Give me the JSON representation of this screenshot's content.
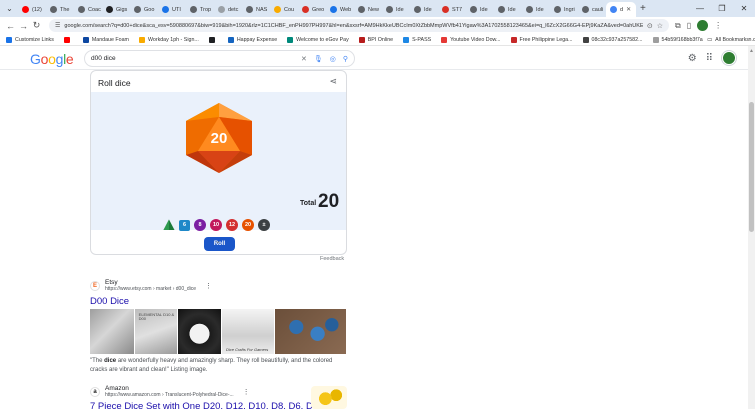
{
  "browser": {
    "tabs": [
      {
        "label": "(12)",
        "color": "#ff0000",
        "active": false
      },
      {
        "label": "The",
        "color": "#5f6368",
        "active": false
      },
      {
        "label": "Coac",
        "color": "#5f6368",
        "active": false
      },
      {
        "label": "Gigs",
        "color": "#202124",
        "active": false
      },
      {
        "label": "Goo",
        "color": "#5f6368",
        "active": false
      },
      {
        "label": "UTI",
        "color": "#1a73e8",
        "active": false
      },
      {
        "label": "Trop",
        "color": "#5f6368",
        "active": false
      },
      {
        "label": "detc",
        "color": "#9aa0a6",
        "active": false
      },
      {
        "label": "NAS",
        "color": "#5f6368",
        "active": false
      },
      {
        "label": "Cou",
        "color": "#f9ab00",
        "active": false
      },
      {
        "label": "Greo",
        "color": "#d93025",
        "active": false
      },
      {
        "label": "Web",
        "color": "#1a73e8",
        "active": false
      },
      {
        "label": "New",
        "color": "#5f6368",
        "active": false
      },
      {
        "label": "Ide",
        "color": "#5f6368",
        "active": false
      },
      {
        "label": "Ide",
        "color": "#5f6368",
        "active": false
      },
      {
        "label": "ST7",
        "color": "#d93025",
        "active": false
      },
      {
        "label": "Ide",
        "color": "#5f6368",
        "active": false
      },
      {
        "label": "Ide",
        "color": "#5f6368",
        "active": false
      },
      {
        "label": "Ide",
        "color": "#5f6368",
        "active": false
      },
      {
        "label": "Ingri",
        "color": "#5f6368",
        "active": false
      },
      {
        "label": "cauli",
        "color": "#5f6368",
        "active": false
      },
      {
        "label": "d",
        "color": "#4285f4",
        "active": true
      }
    ],
    "url": "google.com/search?q=d00+dice&sca_esv=590880697&biw=919&bih=1920&rlz=1C1CHBF_enPH997PH997&hl=en&sxsrf=AM9HkKkeUBCcIm0XtZbbMmpWVfb41Yigaw%3A1702558123465&ei=q_l6ZcX2G66G4-EPj9KaZA&ved=0ahUKEwiN-KGh...",
    "bookmarks": [
      {
        "label": "Customize Links",
        "color": "#1a73e8"
      },
      {
        "label": "",
        "color": "#ff0000"
      },
      {
        "label": "Mandaue Foam",
        "color": "#0d47a1"
      },
      {
        "label": "Workday 1ph - Sign...",
        "color": "#f9ab00"
      },
      {
        "label": "",
        "color": "#202124"
      },
      {
        "label": "Happay Expense",
        "color": "#1565c0"
      },
      {
        "label": "Welcome to eGov Pay",
        "color": "#00897b"
      },
      {
        "label": "BPI Online",
        "color": "#b71c1c"
      },
      {
        "label": "S-PASS",
        "color": "#1e88e5"
      },
      {
        "label": "Youtube Video Dow...",
        "color": "#e53935"
      },
      {
        "label": "Free Philippine Lega...",
        "color": "#c62828"
      },
      {
        "label": "08c32c937a257582...",
        "color": "#424242"
      },
      {
        "label": "54b59f168bb3f7a55...",
        "color": "#9e9e9e"
      },
      {
        "label": "Amazon.com Shoppi...",
        "color": "#212121"
      }
    ],
    "all_bookmarks": "All Bookmarks"
  },
  "google": {
    "query": "d00 dice"
  },
  "dice_card": {
    "title": "Roll dice",
    "die_value": "20",
    "total_label": "Total",
    "total_value": "20",
    "dice_types": [
      {
        "label": "",
        "kind": "d4"
      },
      {
        "label": "6",
        "kind": "d6"
      },
      {
        "label": "8",
        "kind": "d8"
      },
      {
        "label": "10",
        "kind": "d10"
      },
      {
        "label": "12",
        "kind": "d12"
      },
      {
        "label": "20",
        "kind": "d20"
      },
      {
        "label": "±",
        "kind": "dn"
      }
    ],
    "roll_label": "Roll",
    "feedback": "Feedback"
  },
  "results": [
    {
      "site": "Etsy",
      "url": "https://www.etsy.com › market › d00_dice",
      "title": "D00 Dice",
      "thumb_captions": [
        "",
        "ELEMENTAL D10 & D00",
        "",
        "Dice Crafts For Gamers",
        ""
      ],
      "snippet_parts": [
        "\"The ",
        "dice",
        " are wonderfully heavy and amazingly sharp. They roll beautifully, and the colored cracks are vibrant and clean!\" Listing image."
      ]
    },
    {
      "site": "Amazon",
      "url": "https://www.amazon.com › Translucent-Polyhedral-Dice-...",
      "title": "7 Piece Dice Set with One D20, D12, D10, D8, D6, D4, and"
    }
  ]
}
